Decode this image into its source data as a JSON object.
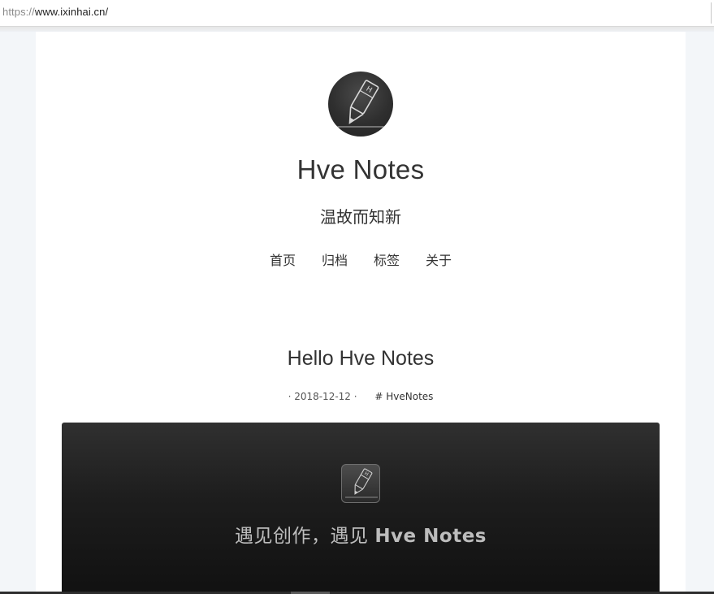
{
  "browser": {
    "url_scheme": "https://",
    "url_host": "www.ixinhai.cn/"
  },
  "header": {
    "avatar_icon": "pencil-h-icon",
    "site_title": "Hve Notes",
    "site_subtitle": "温故而知新"
  },
  "nav": {
    "items": [
      {
        "label": "首页"
      },
      {
        "label": "归档"
      },
      {
        "label": "标签"
      },
      {
        "label": "关于"
      }
    ]
  },
  "post": {
    "title": "Hello Hve Notes",
    "date": "· 2018-12-12 ·",
    "tag": "# HveNotes",
    "feature": {
      "icon": "pencil-h-icon",
      "text_prefix": "遇见创作，遇见 ",
      "text_brand": "Hve Notes"
    }
  },
  "colors": {
    "page_bg": "#f3f6f9",
    "card_bg": "#ffffff",
    "text": "#333333",
    "feature_bg": "#1d1d1d",
    "feature_text": "#bdbdbd"
  }
}
